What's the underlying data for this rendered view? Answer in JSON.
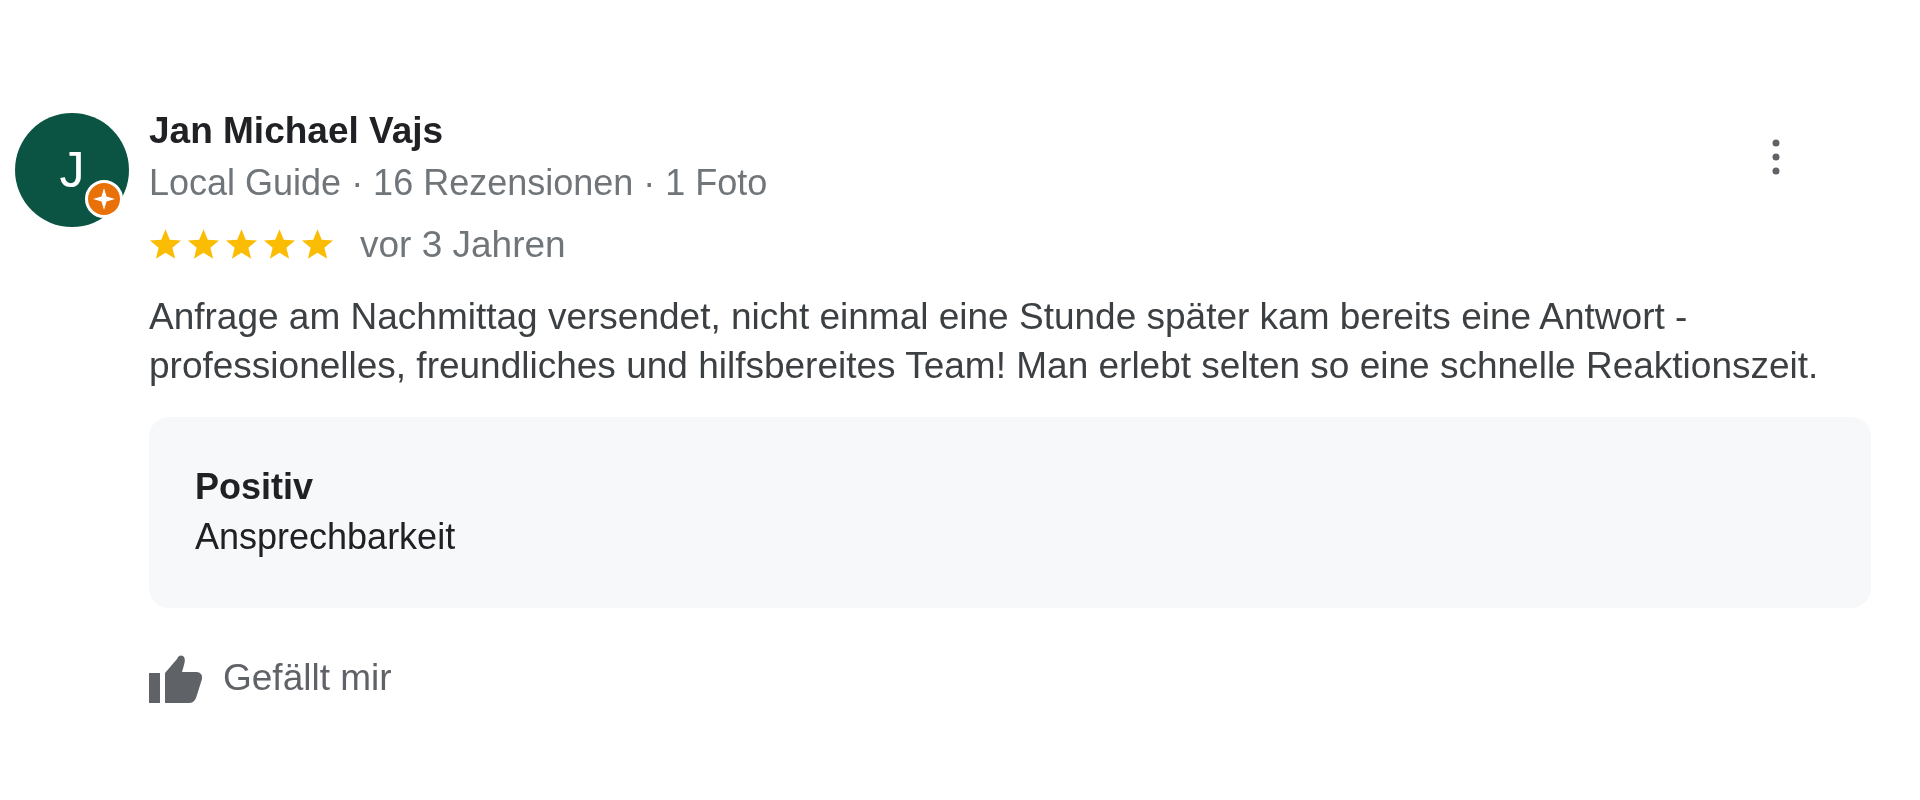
{
  "review": {
    "reviewer_name": "Jan Michael Vajs",
    "avatar_letter": "J",
    "local_guide_badge": true,
    "reviewer_details": "Local Guide · 16 Rezensionen · 1 Foto",
    "stars": 5,
    "time": "vor 3 Jahren",
    "text": "Anfrage am Nachmittag versendet, nicht einmal eine Stunde später kam bereits eine Antwort - professionelles, freundliches und hilfsbereites Team! Man erlebt selten so eine schnelle Reaktionszeit.",
    "highlights": [
      {
        "label": "Positiv",
        "value": "Ansprechbarkeit"
      }
    ],
    "like_button": {
      "label": "Gefällt mir"
    }
  }
}
